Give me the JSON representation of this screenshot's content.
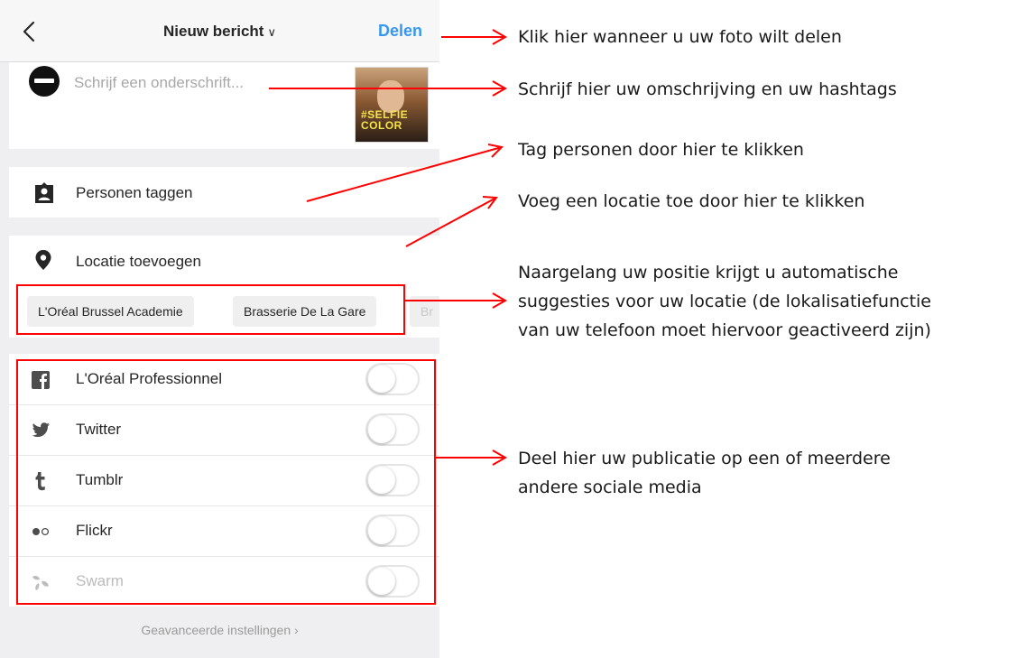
{
  "header": {
    "back_icon": "chevron-left-icon",
    "title": "Nieuw bericht",
    "title_chevron": "∨",
    "share_label": "Delen",
    "accent_color": "#3897f0"
  },
  "caption": {
    "placeholder": "Schrijf een onderschrift...",
    "thumbnail_text": "#SELFIE COLOR"
  },
  "rows": {
    "tag_people": {
      "icon": "tag-person-icon",
      "label": "Personen taggen"
    },
    "add_location": {
      "icon": "location-pin-icon",
      "label": "Locatie toevoegen"
    }
  },
  "location_suggestions": [
    "L'Oréal Brussel Academie",
    "Brasserie De La Gare",
    "Br"
  ],
  "social": [
    {
      "icon": "facebook-icon",
      "label": "L'Oréal Professionnel",
      "enabled": false
    },
    {
      "icon": "twitter-icon",
      "label": "Twitter",
      "enabled": false
    },
    {
      "icon": "tumblr-icon",
      "label": "Tumblr",
      "enabled": false
    },
    {
      "icon": "flickr-icon",
      "label": "Flickr",
      "enabled": false
    },
    {
      "icon": "swarm-icon",
      "label": "Swarm",
      "enabled": false
    }
  ],
  "advanced_settings": "Geavanceerde instellingen",
  "advanced_chevron": "›",
  "annotations": {
    "share": "Klik hier wanneer u uw foto wilt delen",
    "caption": "Schrijf hier uw omschrijving en uw hashtags",
    "tag": "Tag personen door hier te klikken",
    "location": "Voeg een locatie toe door hier te klikken",
    "suggestions_line1": "Naargelang uw positie krijgt u automatische",
    "suggestions_line2": "suggesties voor uw locatie (de lokalisatiefunctie",
    "suggestions_line3": "van uw telefoon moet hiervoor geactiveerd zijn)",
    "social_line1": "Deel hier uw publicatie op een of meerdere",
    "social_line2": "andere sociale media",
    "highlight_color": "#ff0000"
  }
}
